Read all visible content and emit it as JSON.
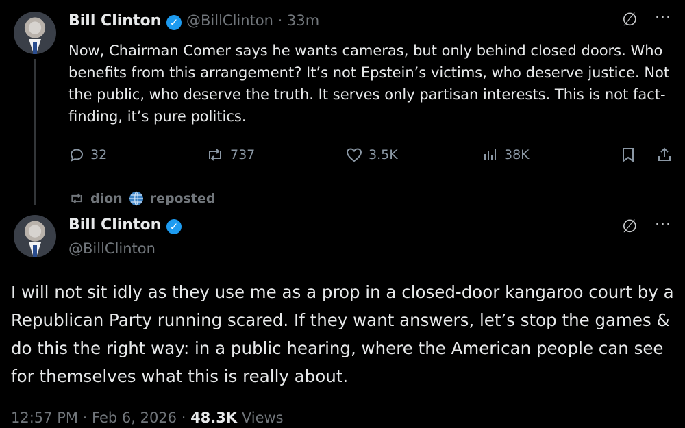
{
  "tweet1": {
    "display_name": "Bill Clinton",
    "handle": "@BillClinton",
    "time": "33m",
    "text": "Now, Chairman Comer says he wants cameras, but only behind closed doors. Who benefits from this arrangement? It’s not Epstein’s victims, who deserve justice. Not the public, who deserve the truth. It serves only partisan interests. This is not fact-finding, it’s pure politics.",
    "replies": "32",
    "reposts": "737",
    "likes": "3.5K",
    "views": "38K"
  },
  "repost_banner": {
    "user": "dion",
    "action": "reposted"
  },
  "tweet2": {
    "display_name": "Bill Clinton",
    "handle": "@BillClinton",
    "text": "I will not sit idly as they use me as a prop in a closed-door kangaroo court by a Republican Party running scared. If they want answers, let’s stop the games & do this the right way: in a public hearing, where the American people can see for themselves what this is really about.",
    "time": "12:57 PM",
    "date": "Feb 6, 2026",
    "views_count": "48.3K",
    "views_label": "Views"
  },
  "icons": {
    "verified": "verified-badge-icon",
    "grok": "grok-icon",
    "more": "more-icon",
    "reply": "reply-icon",
    "repost": "repost-icon",
    "like": "heart-icon",
    "views": "bar-chart-icon",
    "bookmark": "bookmark-icon",
    "share": "share-icon",
    "globe": "globe-icon"
  },
  "colors": {
    "background": "#000000",
    "text": "#e7e9ea",
    "muted": "#71767b",
    "verified": "#1d9bf0"
  }
}
